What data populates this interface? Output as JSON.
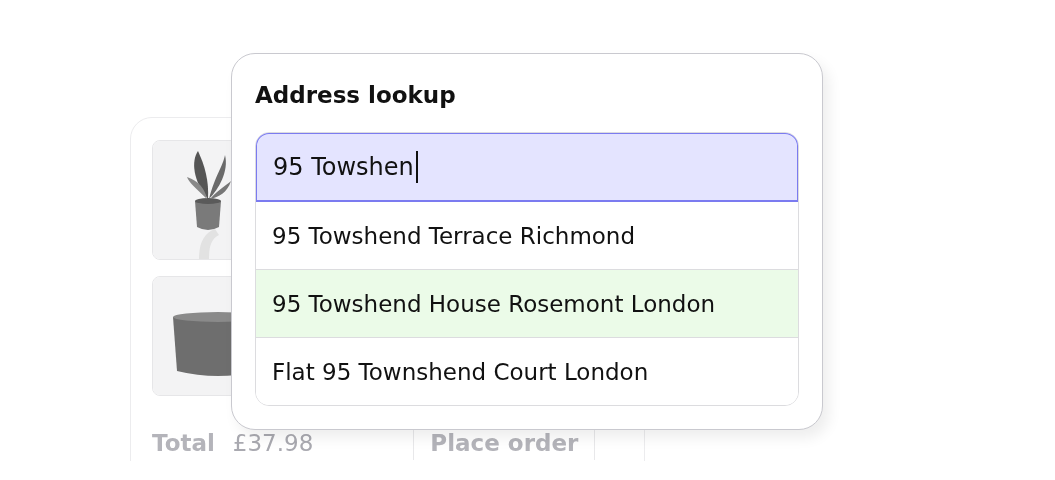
{
  "order_card": {
    "total_label": "Total",
    "total_value": "£37.98",
    "place_order_button": "Place order"
  },
  "address_lookup": {
    "title": "Address lookup",
    "search": {
      "value": "95 Towshen",
      "focused": true
    },
    "suggestions": [
      {
        "label": "95 Towshend Terrace Richmond",
        "selected": false
      },
      {
        "label": "95 Towshend House Rosemont London",
        "selected": true
      },
      {
        "label": "Flat 95 Townshend Court London",
        "selected": false
      }
    ]
  }
}
